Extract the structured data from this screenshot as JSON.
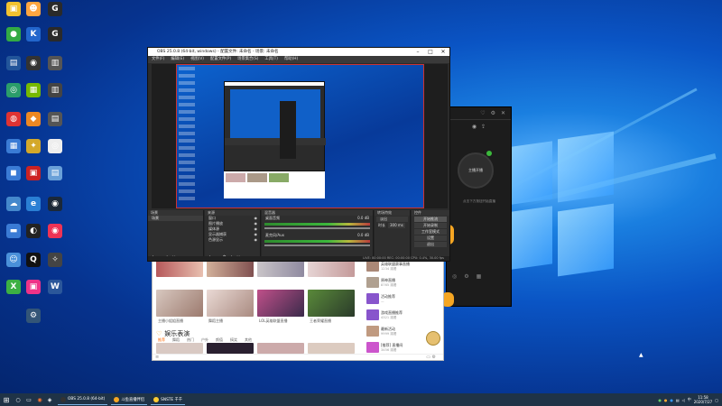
{
  "desktop": {
    "icons": [
      {
        "label": "",
        "color": "#f2c230",
        "glyph": "▣"
      },
      {
        "label": "",
        "color": "#ffa640",
        "glyph": "☻"
      },
      {
        "label": "",
        "color": "#2a2a2a",
        "glyph": "G"
      },
      {
        "label": "",
        "color": "#33aa44",
        "glyph": "●"
      },
      {
        "label": "",
        "color": "#2266cc",
        "glyph": "K"
      },
      {
        "label": "",
        "color": "#2a2a2a",
        "glyph": "G"
      },
      {
        "label": "",
        "color": "#22559a",
        "glyph": "▤"
      },
      {
        "label": "",
        "color": "#333",
        "glyph": "◉"
      },
      {
        "label": "",
        "color": "#555",
        "glyph": "▥"
      },
      {
        "label": "",
        "color": "#2b9d6a",
        "glyph": "◎"
      },
      {
        "label": "",
        "color": "#76b900",
        "glyph": "▦"
      },
      {
        "label": "",
        "color": "#444",
        "glyph": "▥"
      },
      {
        "label": "",
        "color": "#e03333",
        "glyph": "◍"
      },
      {
        "label": "",
        "color": "#ee8822",
        "glyph": "◆"
      },
      {
        "label": "",
        "color": "#555",
        "glyph": "▤"
      },
      {
        "label": "",
        "color": "#3a7bd5",
        "glyph": "▦"
      },
      {
        "label": "",
        "color": "#d4a82a",
        "glyph": "✦"
      },
      {
        "label": "",
        "color": "#eee",
        "glyph": "◎"
      },
      {
        "label": "",
        "color": "#3a7bd5",
        "glyph": "◼"
      },
      {
        "label": "",
        "color": "#cc2222",
        "glyph": "▣"
      },
      {
        "label": "",
        "color": "#6aa0d8",
        "glyph": "▤"
      },
      {
        "label": "",
        "color": "#4488cc",
        "glyph": "☁"
      },
      {
        "label": "",
        "color": "#2a7fd4",
        "glyph": "e"
      },
      {
        "label": "",
        "color": "#1b2838",
        "glyph": "◉"
      },
      {
        "label": "",
        "color": "#3a7bd5",
        "glyph": "▬"
      },
      {
        "label": "",
        "color": "#222",
        "glyph": "◐"
      },
      {
        "label": "",
        "color": "#ee3355",
        "glyph": "◉"
      },
      {
        "label": "",
        "color": "#4a90d9",
        "glyph": "☺"
      },
      {
        "label": "",
        "color": "#111",
        "glyph": "Q"
      },
      {
        "label": "",
        "color": "#444",
        "glyph": "✧"
      },
      {
        "label": "",
        "color": "#3cb043",
        "glyph": "X"
      },
      {
        "label": "",
        "color": "#ee3388",
        "glyph": "▣"
      },
      {
        "label": "",
        "color": "#2b579a",
        "glyph": "W"
      },
      {
        "label": "",
        "color": "#335577",
        "glyph": "⚙"
      }
    ]
  },
  "obs": {
    "title": "OBS 25.0.8 (64-bit, windows) - 配置文件: 未命名 - 场景: 未命名",
    "menu": [
      "文件(F)",
      "编辑(E)",
      "视图(V)",
      "配置文件(P)",
      "场景集合(S)",
      "工具(T)",
      "帮助(H)"
    ],
    "docks": {
      "scenes_title": "场景",
      "scenes": [
        "场景"
      ],
      "sources_title": "来源",
      "sources": [
        "窗口",
        "图片播放",
        "媒体源",
        "显示器捕获",
        "色源显示"
      ],
      "mixer_title": "混音器",
      "mixer": [
        {
          "name": "桌面音频",
          "db": "0.0 dB"
        },
        {
          "name": "麦克风/Aux",
          "db": "0.0 dB"
        }
      ],
      "transitions_title": "转场特效",
      "transition_value": "淡出",
      "duration_label": "时长",
      "duration_value": "300 ms",
      "controls_title": "控件",
      "controls": [
        "开始推流",
        "开始录制",
        "工作室模式",
        "设置",
        "退出"
      ]
    },
    "status": "LIVE: 00:00:00   REC: 00:00:00   CPU: 0.4%, 30.00 fps"
  },
  "browser": {
    "section_title": "娱乐表演",
    "tabs": [
      "推荐",
      "舞蹈",
      "热门",
      "户外",
      "颜值",
      "搞笑",
      "其他"
    ],
    "captions": [
      "主播小姐姐直播",
      "舞蹈主播",
      "LOL英雄联盟直播",
      "王者荣耀直播"
    ],
    "side_items": [
      {
        "title": "英雄联盟赛事直播",
        "sub": "1234 观看"
      },
      {
        "title": "原神直播",
        "sub": "8765 观看"
      },
      {
        "title": "活动推荐",
        "sub": "—"
      },
      {
        "title": "游戏直播推荐",
        "sub": "4321 观看"
      },
      {
        "title": "最新活动",
        "sub": "9999 观看"
      },
      {
        "title": "[推荐] 直播间",
        "sub": "3456 观看"
      }
    ]
  },
  "dark_app": {
    "label": "主播开播",
    "sub": "点击下方按钮开始直播"
  },
  "taskbar": {
    "tasks": [
      {
        "label": "OBS 25.0.8 (64-bit)"
      },
      {
        "label": "斗鱼直播伴侣"
      },
      {
        "label": "SNSTE 千千"
      }
    ],
    "time": "11:58",
    "date": "2020/7/27"
  },
  "colors": {
    "accent": "#1a7fe0",
    "taskbar": "#1f3347"
  }
}
